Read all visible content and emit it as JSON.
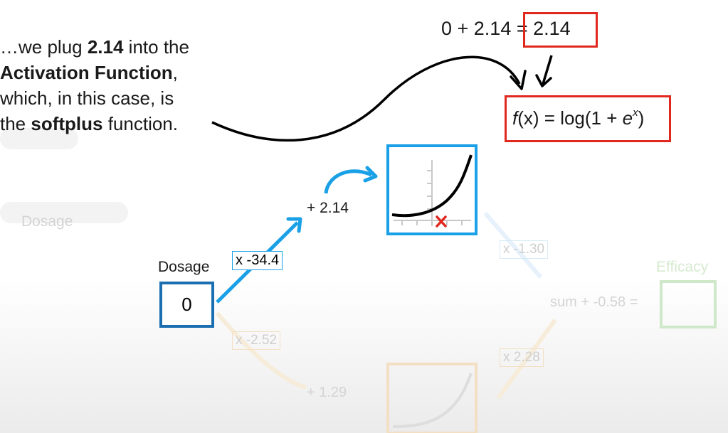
{
  "narration": {
    "line1_pre": "…we plug ",
    "line1_bold": "2.14",
    "line1_post": " into the",
    "line2_bold": "Activation Function",
    "line2_post": ",",
    "line3": "which, in this case, is",
    "line4_pre": "the ",
    "line4_bold": "softplus",
    "line4_post": " function."
  },
  "equation": {
    "lhs": "0 + 2.14 ",
    "rhs": "= 2.14"
  },
  "formula": {
    "fx": "f",
    "x_paren": "(x)",
    "middle": " = log(1 + ",
    "e": "e",
    "exp": "x",
    "close": ")"
  },
  "nodes": {
    "input_label": "Dosage",
    "input_value": "0",
    "weight_top": "x -34.4",
    "bias_top": "+ 2.14",
    "weight_bottom": "x -2.52",
    "bias_bottom": "+ 1.29",
    "weight_out_top": "x -1.30",
    "weight_out_bottom": "x 2.28",
    "sum_text": "sum + -0.58 =",
    "output_label": "Efficacy",
    "faded_input_label": "Dosage",
    "marker": "x"
  },
  "colors": {
    "red": "#e0281f",
    "blue": "#1b6fb0",
    "light_blue": "#1aa0e6",
    "green_faded": "#cfe8c9",
    "orange_faded": "#f3dfc4"
  }
}
